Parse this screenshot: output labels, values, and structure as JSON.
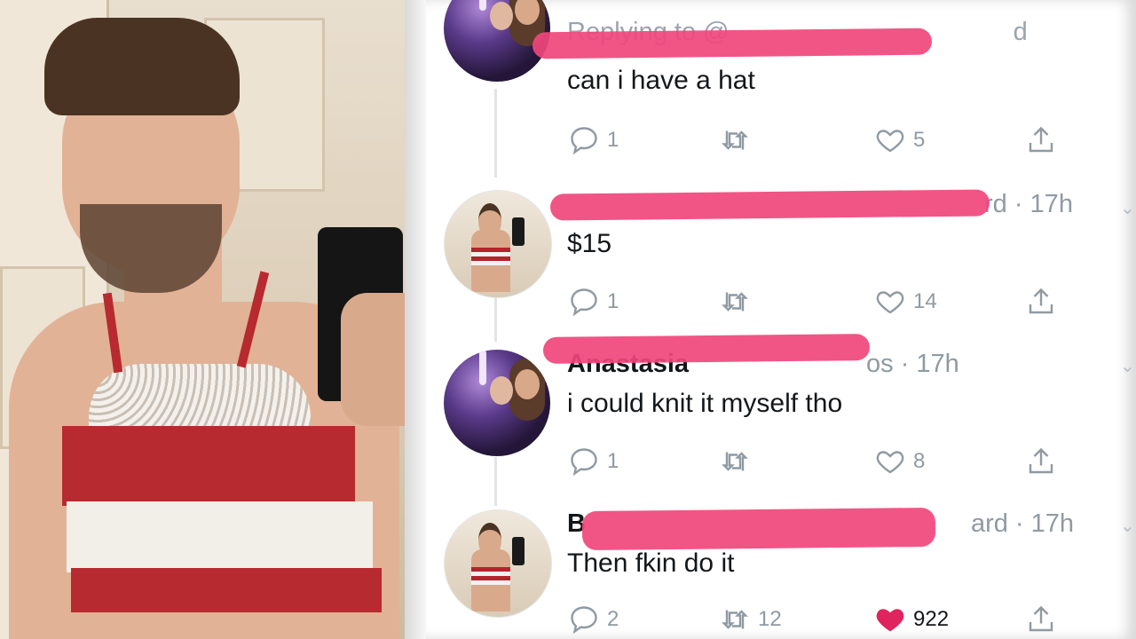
{
  "tweets": [
    {
      "handle_suffix": "Replying to @",
      "handle_suffix_tail": "d",
      "text": "can i have a hat",
      "reply_count": "1",
      "retweet_count": "",
      "like_count": "5",
      "liked": false
    },
    {
      "handle_tail": "rd · 17h",
      "text": "$15",
      "reply_count": "1",
      "retweet_count": "",
      "like_count": "14",
      "liked": false
    },
    {
      "name": "Anastasia",
      "handle_tail": "os · 17h",
      "text": "i could knit it myself tho",
      "reply_count": "1",
      "retweet_count": "",
      "like_count": "8",
      "liked": false
    },
    {
      "name_initial": "B",
      "handle_tail": "ard · 17h",
      "text": "Then fkin do it",
      "reply_count": "2",
      "retweet_count": "12",
      "like_count": "922",
      "liked": true
    }
  ],
  "colors": {
    "like_red": "#e0245e",
    "redaction": "#f0467c",
    "muted": "#8f9aa3"
  },
  "icons": [
    "reply-icon",
    "retweet-icon",
    "like-icon",
    "share-icon",
    "chevron-down-icon"
  ]
}
